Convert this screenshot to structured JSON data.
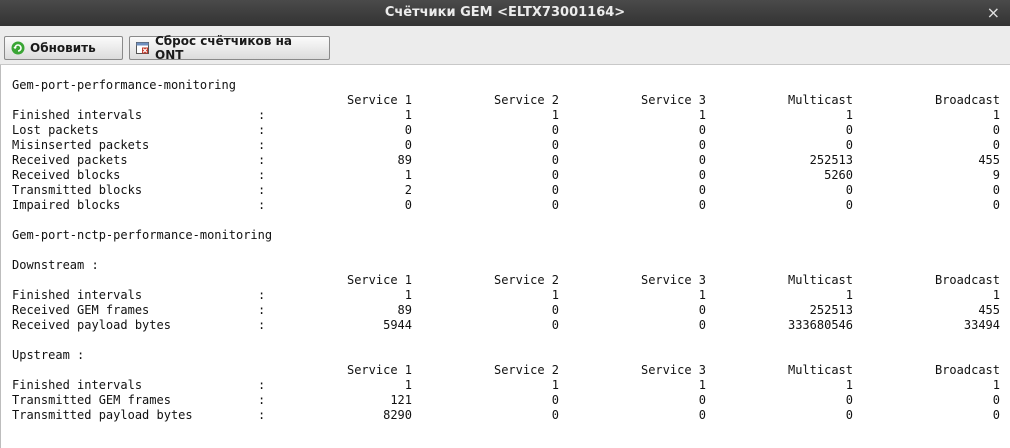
{
  "window": {
    "title": "Счётчики GEM <ELTX73001164>",
    "close_glyph": "×"
  },
  "toolbar": {
    "refresh_label": "Обновить",
    "reset_label": "Сброс счётчиков на ONT"
  },
  "colors": {
    "titlebar": "#3b3b3b",
    "refresh_icon": "#3aa535",
    "reset_icon": "#c0392b"
  },
  "columns": [
    "Service 1",
    "Service 2",
    "Service 3",
    "Multicast",
    "Broadcast"
  ],
  "colon": ":",
  "sections": [
    {
      "title": "Gem-port-performance-monitoring",
      "rows": [
        {
          "label": "Finished intervals",
          "values": [
            "1",
            "1",
            "1",
            "1",
            "1"
          ]
        },
        {
          "label": "Lost packets",
          "values": [
            "0",
            "0",
            "0",
            "0",
            "0"
          ]
        },
        {
          "label": "Misinserted packets",
          "values": [
            "0",
            "0",
            "0",
            "0",
            "0"
          ]
        },
        {
          "label": "Received packets",
          "values": [
            "89",
            "0",
            "0",
            "252513",
            "455"
          ]
        },
        {
          "label": "Received blocks",
          "values": [
            "1",
            "0",
            "0",
            "5260",
            "9"
          ]
        },
        {
          "label": "Transmitted blocks",
          "values": [
            "2",
            "0",
            "0",
            "0",
            "0"
          ]
        },
        {
          "label": "Impaired blocks",
          "values": [
            "0",
            "0",
            "0",
            "0",
            "0"
          ]
        }
      ]
    },
    {
      "title": "Gem-port-nctp-performance-monitoring"
    },
    {
      "title": "Downstream :",
      "rows": [
        {
          "label": "Finished intervals",
          "values": [
            "1",
            "1",
            "1",
            "1",
            "1"
          ]
        },
        {
          "label": "Received GEM frames",
          "values": [
            "89",
            "0",
            "0",
            "252513",
            "455"
          ]
        },
        {
          "label": "Received payload bytes",
          "values": [
            "5944",
            "0",
            "0",
            "333680546",
            "33494"
          ]
        }
      ]
    },
    {
      "title": "Upstream :",
      "rows": [
        {
          "label": "Finished intervals",
          "values": [
            "1",
            "1",
            "1",
            "1",
            "1"
          ]
        },
        {
          "label": "Transmitted GEM frames",
          "values": [
            "121",
            "0",
            "0",
            "0",
            "0"
          ]
        },
        {
          "label": "Transmitted payload bytes",
          "values": [
            "8290",
            "0",
            "0",
            "0",
            "0"
          ]
        }
      ]
    }
  ]
}
